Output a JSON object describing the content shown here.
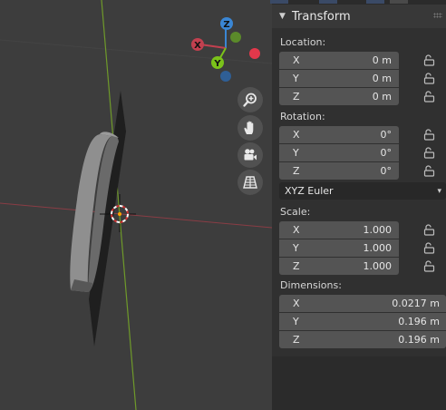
{
  "panel": {
    "title": "Transform",
    "location": {
      "label": "Location:",
      "rows": [
        {
          "axis": "X",
          "value": "0 m"
        },
        {
          "axis": "Y",
          "value": "0 m"
        },
        {
          "axis": "Z",
          "value": "0 m"
        }
      ]
    },
    "rotation": {
      "label": "Rotation:",
      "rows": [
        {
          "axis": "X",
          "value": "0°"
        },
        {
          "axis": "Y",
          "value": "0°"
        },
        {
          "axis": "Z",
          "value": "0°"
        }
      ],
      "mode": "XYZ Euler"
    },
    "scale": {
      "label": "Scale:",
      "rows": [
        {
          "axis": "X",
          "value": "1.000"
        },
        {
          "axis": "Y",
          "value": "1.000"
        },
        {
          "axis": "Z",
          "value": "1.000"
        }
      ]
    },
    "dimensions": {
      "label": "Dimensions:",
      "rows": [
        {
          "axis": "X",
          "value": "0.0217 m"
        },
        {
          "axis": "Y",
          "value": "0.196 m"
        },
        {
          "axis": "Z",
          "value": "0.196 m"
        }
      ]
    }
  },
  "gizmo": {
    "z_label": "Z",
    "x_label": "X",
    "y_label": "Y",
    "colors": {
      "x": "#c2404f",
      "y": "#7bc21a",
      "z": "#3a86d4",
      "neg_x": "#e3384b",
      "neg_y": "#2f5f96",
      "neg_z": "#5b8a2a"
    }
  },
  "viewport_tools": [
    {
      "name": "zoom-icon"
    },
    {
      "name": "hand-pan-icon"
    },
    {
      "name": "camera-icon"
    },
    {
      "name": "grid-perspective-icon"
    }
  ]
}
